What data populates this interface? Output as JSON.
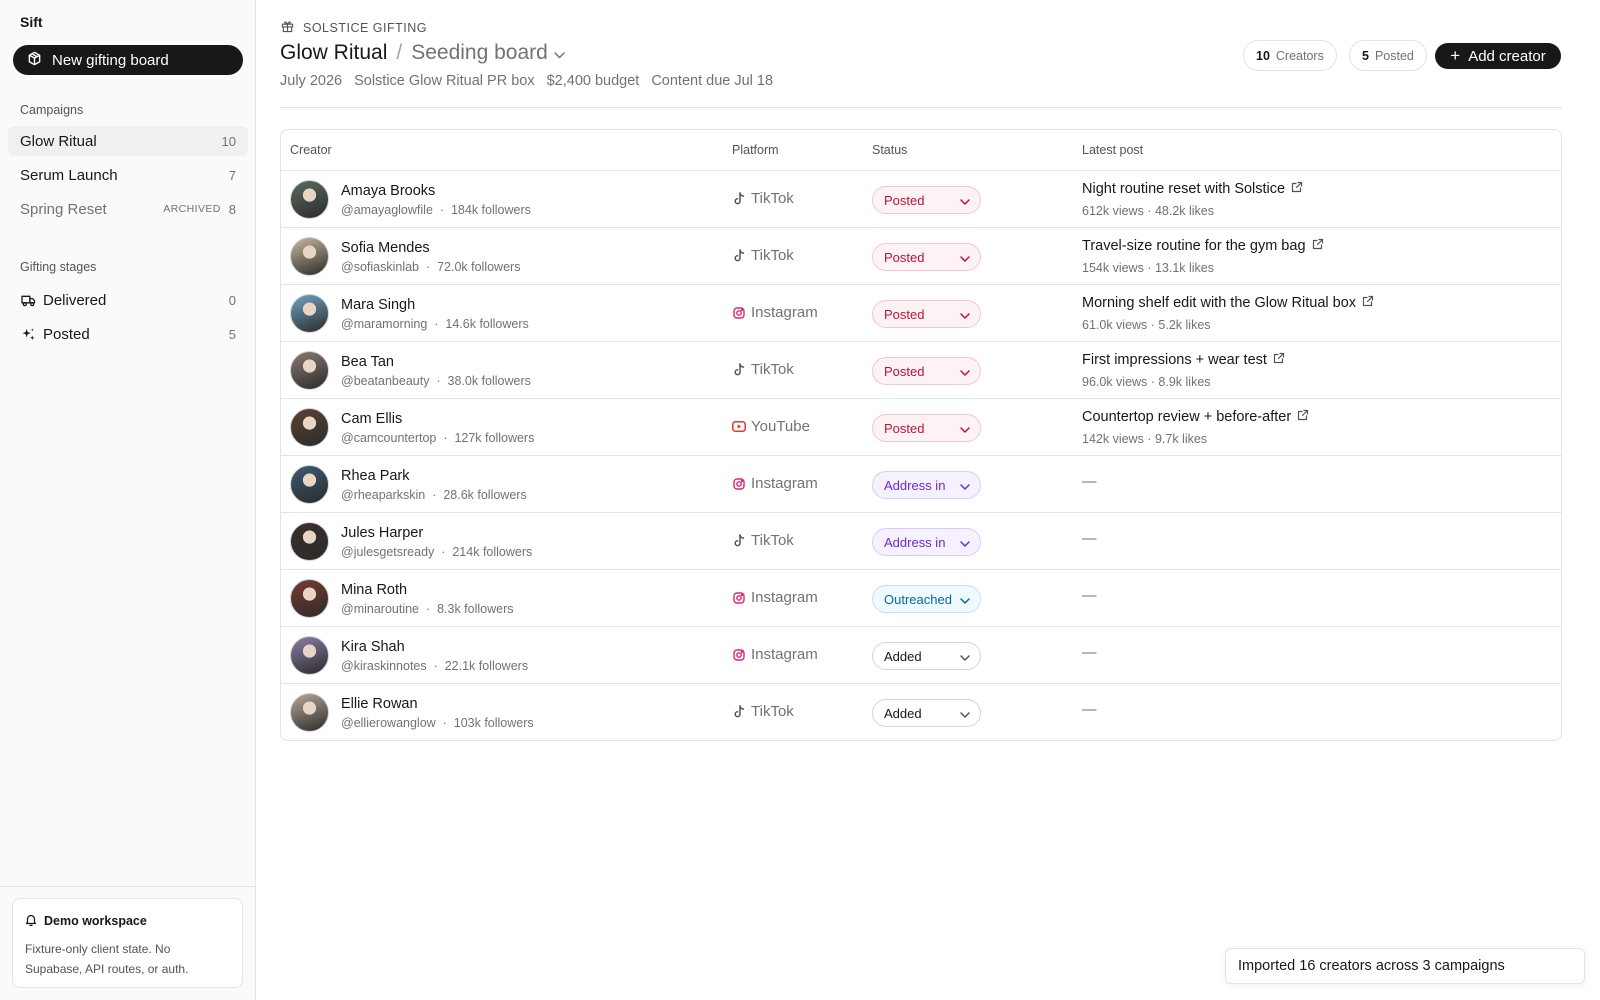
{
  "sidebar": {
    "brand": "Sift",
    "new_board_label": "New gifting board",
    "campaigns_label": "Campaigns",
    "campaigns": [
      {
        "name": "Glow Ritual",
        "count": "10",
        "tag": ""
      },
      {
        "name": "Serum Launch",
        "count": "7",
        "tag": ""
      },
      {
        "name": "Spring Reset",
        "count": "8",
        "tag": "ARCHIVED"
      }
    ],
    "stages_label": "Gifting stages",
    "stages": [
      {
        "name": "Delivered",
        "count": "0",
        "icon": "truck-icon"
      },
      {
        "name": "Posted",
        "count": "5",
        "icon": "sparkles-icon"
      }
    ],
    "demo": {
      "title": "Demo workspace",
      "text": "Fixture-only client state. No Supabase, API routes, or auth."
    }
  },
  "header": {
    "eyebrow": "SOLSTICE GIFTING",
    "title": "Glow Ritual",
    "separator": "/",
    "subtitle": "Seeding board",
    "meta": [
      "July 2026",
      "Solstice Glow Ritual PR box",
      "$2,400 budget",
      "Content due Jul 18"
    ],
    "creators_count": "10",
    "creators_label": "Creators",
    "posted_count": "5",
    "posted_label": "Posted",
    "add_label": "Add creator"
  },
  "table": {
    "columns": [
      "Creator",
      "Platform",
      "Status",
      "Latest post"
    ],
    "rows": [
      {
        "name": "Amaya Brooks",
        "handle": "@amayaglowfile",
        "followers": "184k followers",
        "platform": "TikTok",
        "status": "Posted",
        "post_title": "Night routine reset with Solstice",
        "post_stats": "612k views · 48.2k likes",
        "avatar_color": "#5b6b5e"
      },
      {
        "name": "Sofia Mendes",
        "handle": "@sofiaskinlab",
        "followers": "72.0k followers",
        "platform": "TikTok",
        "status": "Posted",
        "post_title": "Travel-size routine for the gym bag",
        "post_stats": "154k views · 13.1k likes",
        "avatar_color": "#c9b79e"
      },
      {
        "name": "Mara Singh",
        "handle": "@maramorning",
        "followers": "14.6k followers",
        "platform": "Instagram",
        "status": "Posted",
        "post_title": "Morning shelf edit with the Glow Ritual box",
        "post_stats": "61.0k views · 5.2k likes",
        "avatar_color": "#6fa3c4"
      },
      {
        "name": "Bea Tan",
        "handle": "@beatanbeauty",
        "followers": "38.0k followers",
        "platform": "TikTok",
        "status": "Posted",
        "post_title": "First impressions + wear test",
        "post_stats": "96.0k views · 8.9k likes",
        "avatar_color": "#8a7a72"
      },
      {
        "name": "Cam Ellis",
        "handle": "@camcountertop",
        "followers": "127k followers",
        "platform": "YouTube",
        "status": "Posted",
        "post_title": "Countertop review + before-after",
        "post_stats": "142k views · 9.7k likes",
        "avatar_color": "#5a4332"
      },
      {
        "name": "Rhea Park",
        "handle": "@rheaparkskin",
        "followers": "28.6k followers",
        "platform": "Instagram",
        "status": "Address in",
        "post_title": "",
        "post_stats": "",
        "post_empty": "—",
        "avatar_color": "#3e5a78"
      },
      {
        "name": "Jules Harper",
        "handle": "@julesgetsready",
        "followers": "214k followers",
        "platform": "TikTok",
        "status": "Address in",
        "post_title": "",
        "post_stats": "",
        "post_empty": "—",
        "avatar_color": "#3a2e2b"
      },
      {
        "name": "Mina Roth",
        "handle": "@minaroutine",
        "followers": "8.3k followers",
        "platform": "Instagram",
        "status": "Outreached",
        "post_title": "",
        "post_stats": "",
        "post_empty": "—",
        "avatar_color": "#7a3b34"
      },
      {
        "name": "Kira Shah",
        "handle": "@kiraskinnotes",
        "followers": "22.1k followers",
        "platform": "Instagram",
        "status": "Added",
        "post_title": "",
        "post_stats": "",
        "post_empty": "—",
        "avatar_color": "#8c7fa8"
      },
      {
        "name": "Ellie Rowan",
        "handle": "@ellierowanglow",
        "followers": "103k followers",
        "platform": "TikTok",
        "status": "Added",
        "post_title": "",
        "post_stats": "",
        "post_empty": "—",
        "avatar_color": "#b8a89a"
      }
    ]
  },
  "status_styles": {
    "Posted": {
      "bg": "#fdf2f4",
      "border": "#f4c6cf",
      "color": "#be123c"
    },
    "Address in": {
      "bg": "#f6f1fe",
      "border": "#dccafb",
      "color": "#6d28d9"
    },
    "Outreached": {
      "bg": "#f0f9ff",
      "border": "#bae3fb",
      "color": "#0369a1"
    },
    "Added": {
      "bg": "#ffffff",
      "border": "#d4d4d8",
      "color": "#18181b"
    }
  },
  "toast": "Imported 16 creators across 3 campaigns"
}
